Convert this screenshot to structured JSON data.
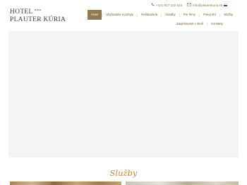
{
  "header": {
    "logo_line1": "HOTEL",
    "logo_stars": "***",
    "logo_line2": "PLAUTER KÚRIA",
    "phone": "+421 917 232 545",
    "email": "info@plauterkuria.sk",
    "language_flag": "slovak-flag"
  },
  "nav": {
    "row1": [
      {
        "label": "Hotel",
        "active": true
      },
      {
        "label": "Ubytovanie a pobyty",
        "active": false
      },
      {
        "label": "Reštaurácia",
        "active": false
      },
      {
        "label": "Svadby",
        "active": false
      },
      {
        "label": "Pre firmy",
        "active": false
      },
      {
        "label": "Pokoj dní",
        "active": false
      },
      {
        "label": "Služby",
        "active": false
      }
    ],
    "row2": [
      {
        "label": "Zaujímavosti v okolí"
      },
      {
        "label": "Kontakty"
      }
    ]
  },
  "section": {
    "title": "Služby"
  },
  "colors": {
    "accent": "#8f7a55",
    "title": "#bf8c3c"
  }
}
